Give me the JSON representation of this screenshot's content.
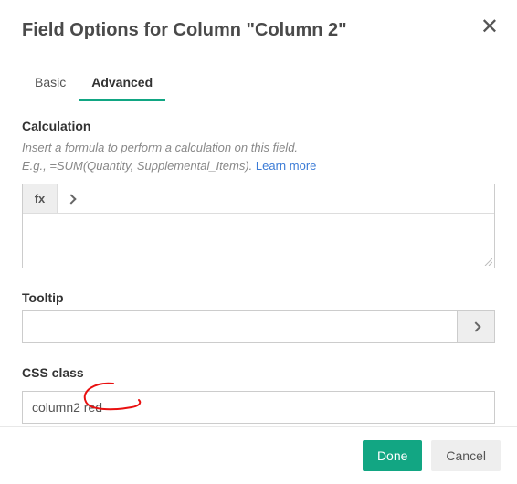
{
  "title": "Field Options for Column \"Column 2\"",
  "tabs": {
    "basic": "Basic",
    "advanced": "Advanced"
  },
  "calc": {
    "label": "Calculation",
    "helper1": "Insert a formula to perform a calculation on this field.",
    "helper2": "E.g., =SUM(Quantity, Supplemental_Items).",
    "learn": "Learn more",
    "fx": "fx",
    "value": ""
  },
  "tooltip": {
    "label": "Tooltip",
    "value": ""
  },
  "css": {
    "label": "CSS class",
    "value": "column2 red"
  },
  "footer": {
    "done": "Done",
    "cancel": "Cancel"
  }
}
